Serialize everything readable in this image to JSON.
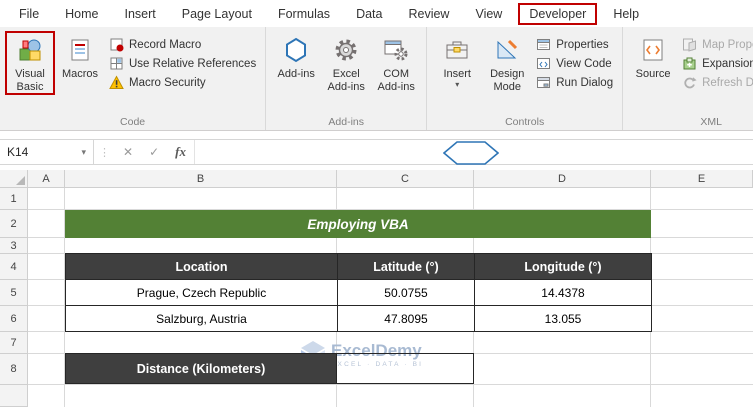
{
  "tabs": [
    "File",
    "Home",
    "Insert",
    "Page Layout",
    "Formulas",
    "Data",
    "Review",
    "View",
    "Developer",
    "Help"
  ],
  "ribbon": {
    "code": {
      "label": "Code",
      "visual_basic": "Visual Basic",
      "macros": "Macros",
      "record_macro": "Record Macro",
      "use_relative_references": "Use Relative References",
      "macro_security": "Macro Security"
    },
    "addins": {
      "label": "Add-ins",
      "addins": "Add-ins",
      "excel_addins": "Excel Add-ins",
      "com_addins": "COM Add-ins"
    },
    "controls": {
      "label": "Controls",
      "insert": "Insert",
      "design_mode": "Design Mode",
      "properties": "Properties",
      "view_code": "View Code",
      "run_dialog": "Run Dialog"
    },
    "xml": {
      "label": "XML",
      "source": "Source",
      "map_properties": "Map Properties",
      "expansion_packs": "Expansion Packs",
      "refresh_data": "Refresh Data"
    }
  },
  "icons": {
    "caret_down": "▾",
    "cancel": "✕",
    "enter": "✓",
    "dots": "⋮"
  },
  "formula_bar": {
    "name_box": "K14",
    "fx_label": "fx"
  },
  "sheet": {
    "columns": [
      "A",
      "B",
      "C",
      "D",
      "E"
    ],
    "rows": [
      "1",
      "2",
      "3",
      "4",
      "5",
      "6",
      "7",
      "8"
    ],
    "banner_title": "Employing VBA",
    "table": {
      "headers": [
        "Location",
        "Latitude (°)",
        "Longitude (°)"
      ],
      "rows": [
        [
          "Prague, Czech Republic",
          "50.0755",
          "14.4378"
        ],
        [
          "Salzburg, Austria",
          "47.8095",
          "13.055"
        ]
      ]
    },
    "distance_label": "Distance (Kilometers)"
  },
  "watermark": {
    "brand": "ExcelDemy",
    "tagline": "EXCEL · DATA · BI"
  },
  "colors": {
    "banner_green": "#538135",
    "table_header_dark": "#3f3f3f",
    "highlight_red": "#c00000",
    "accent_blue": "#2e75b6",
    "watermark_blue": "#b4c7e7"
  }
}
